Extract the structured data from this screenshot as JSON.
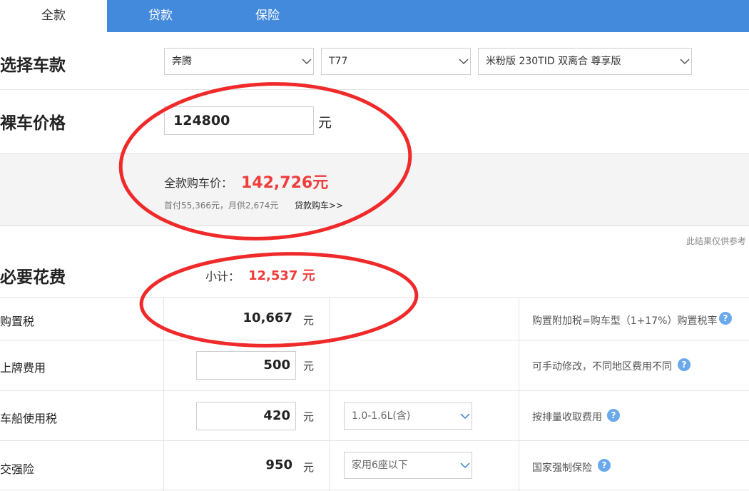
{
  "tabs": [
    {
      "label": "全款",
      "active": true
    },
    {
      "label": "贷款",
      "active": false
    },
    {
      "label": "保险",
      "active": false
    }
  ],
  "select_car": {
    "label": "选择车款",
    "brand": "奔腾",
    "model": "T77",
    "version": "米粉版 230TID 双离合 尊享版"
  },
  "bare_price": {
    "label": "裸车价格",
    "value": "124800",
    "unit": "元"
  },
  "summary": {
    "total_label": "全款购车价：",
    "total_value": "142,726元",
    "detail": "首付55,366元，月供2,674元",
    "loan_link": "贷款购车>>"
  },
  "disclaimer": "此结果仅供参考",
  "required": {
    "label": "必要花费",
    "subtotal_label": "小计：",
    "subtotal_value": "12,537 元",
    "rows": [
      {
        "label": "购置税",
        "value": "10,667",
        "unit": "元",
        "editable": false,
        "option": "",
        "note": "购置附加税=购车型（1+17%）购置税率"
      },
      {
        "label": "上牌费用",
        "value": "500",
        "unit": "元",
        "editable": true,
        "option": "",
        "note": "可手动修改，不同地区费用不同"
      },
      {
        "label": "车船使用税",
        "value": "420",
        "unit": "元",
        "editable": true,
        "option": "1.0-1.6L(含)",
        "note": "按排量收取费用"
      },
      {
        "label": "交强险",
        "value": "950",
        "unit": "元",
        "editable": false,
        "option": "家用6座以下",
        "note": "国家强制保险"
      }
    ]
  },
  "help_glyph": "?",
  "colors": {
    "tab_bar": "#4389dc",
    "accent_red": "#f03c3c",
    "annotation_red": "#f02a2a",
    "help_icon": "#6aa9ec"
  },
  "icons": [
    "chevron-down-icon",
    "help-icon"
  ]
}
